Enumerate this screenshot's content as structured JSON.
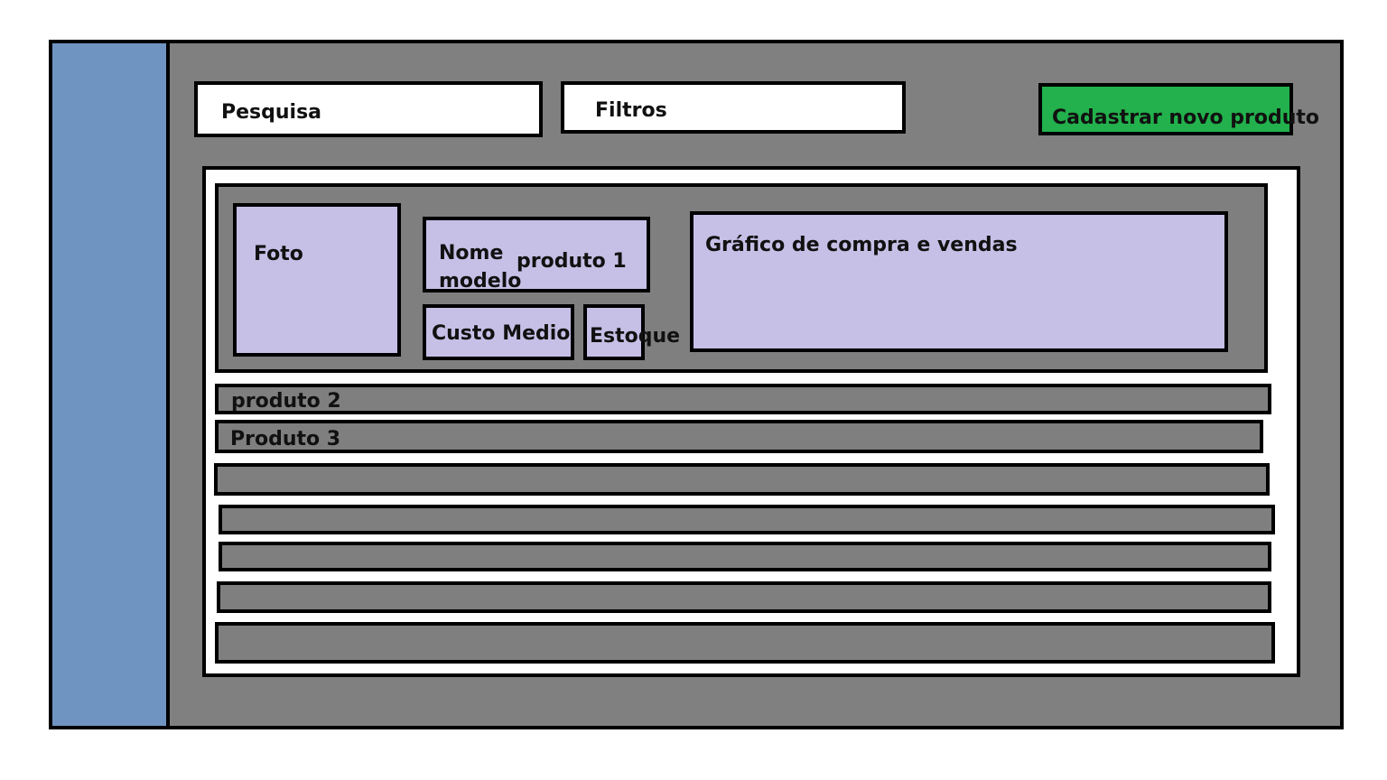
{
  "toolbar": {
    "search_label": "Pesquisa",
    "filters_label": "Filtros",
    "new_product_label": "Cadastrar novo produto"
  },
  "expanded_product": {
    "photo_label": "Foto",
    "name_label": "Nome",
    "model_label": "modelo",
    "product_name": "produto 1",
    "avg_cost_label": "Custo Medio",
    "stock_label": "Estoque",
    "chart_label": "Gráfico de compra e vendas"
  },
  "product_rows": [
    {
      "label": "produto 2"
    },
    {
      "label": "Produto 3"
    },
    {
      "label": ""
    },
    {
      "label": ""
    },
    {
      "label": ""
    },
    {
      "label": ""
    },
    {
      "label": ""
    }
  ],
  "colors": {
    "background": "#808080",
    "sidebar": "#7094c2",
    "card": "#c6bfe6",
    "primary_button": "#22b14c"
  }
}
